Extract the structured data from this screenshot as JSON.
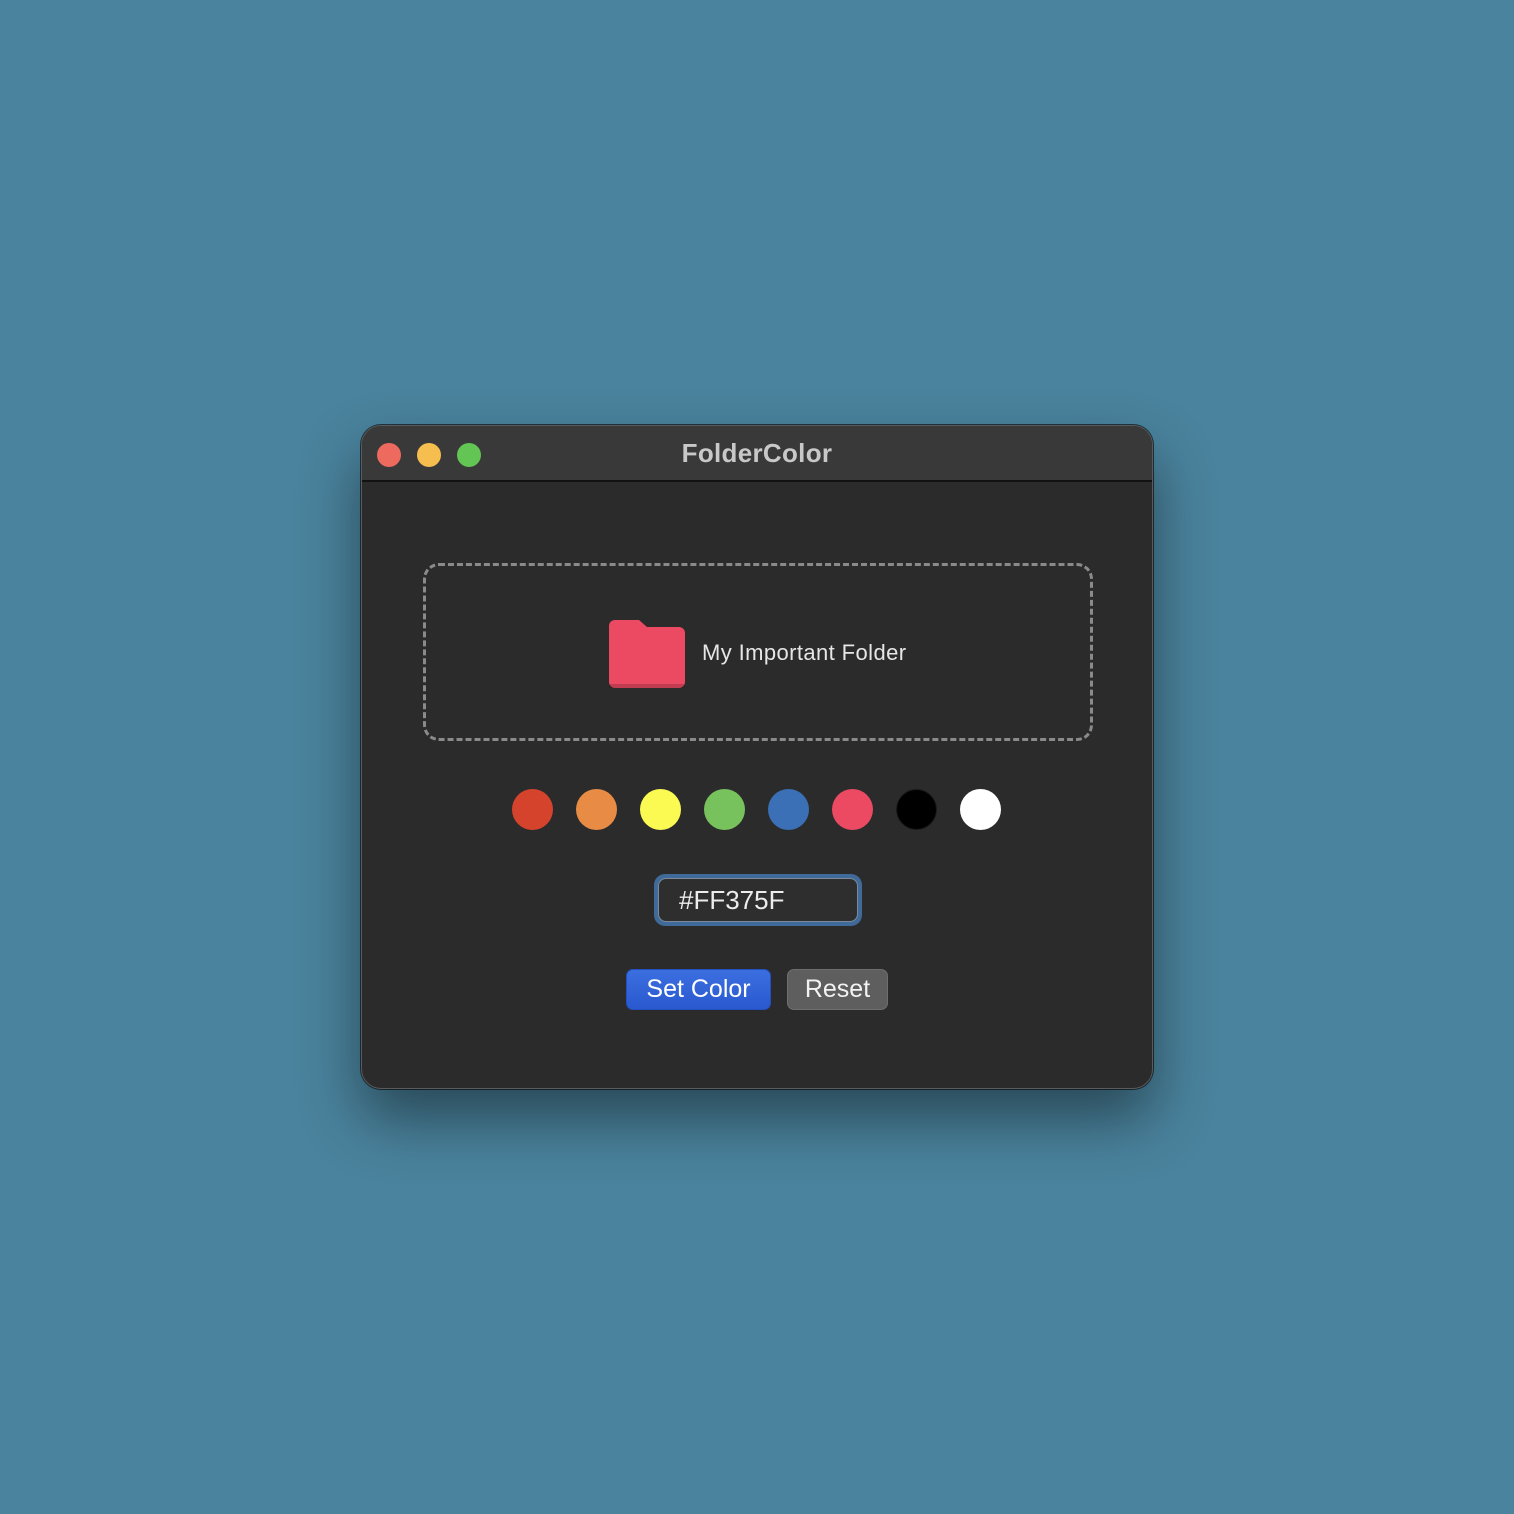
{
  "window": {
    "title": "FolderColor"
  },
  "dropzone": {
    "folder_name": "My Important Folder",
    "folder_color": "#EB4A62"
  },
  "swatches": [
    {
      "name": "red",
      "color": "#D6432C"
    },
    {
      "name": "orange",
      "color": "#E88B45"
    },
    {
      "name": "yellow",
      "color": "#FBFA52"
    },
    {
      "name": "green",
      "color": "#78C25E"
    },
    {
      "name": "blue",
      "color": "#3B70B7"
    },
    {
      "name": "pink",
      "color": "#EB4A62"
    },
    {
      "name": "black",
      "color": "#000000"
    },
    {
      "name": "white",
      "color": "#FFFFFF"
    }
  ],
  "hex_input": {
    "value": "#FF375F"
  },
  "buttons": {
    "set_color_label": "Set Color",
    "reset_label": "Reset"
  },
  "colors": {
    "desktop_background": "#4A839D",
    "window_background": "#2B2B2B",
    "accent": "#2A58CF"
  }
}
